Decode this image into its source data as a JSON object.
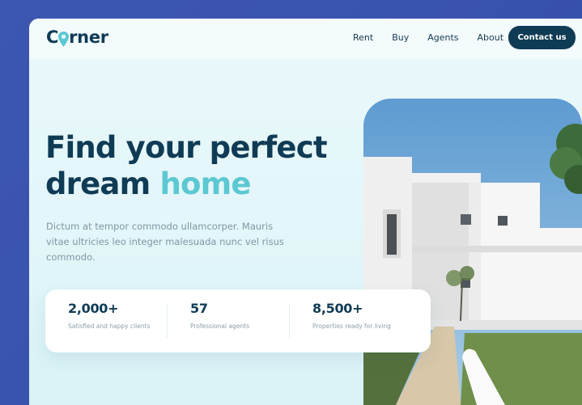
{
  "brand": {
    "name": "Corner",
    "accent": "#5bc8d2",
    "primary": "#0f3b55"
  },
  "nav": {
    "links": [
      "Rent",
      "Buy",
      "Agents",
      "About"
    ],
    "cta": "Contact us"
  },
  "hero": {
    "title_line1": "Find your perfect",
    "title_line2_a": "dream",
    "title_line2_b": "home",
    "description": "Dictum at tempor commodo ullamcorper. Mauris vitae ultricies leo integer malesuada nunc vel risus commodo."
  },
  "stats": [
    {
      "value": "2,000+",
      "label": "Satisfied and happy clients"
    },
    {
      "value": "57",
      "label": "Professional agents"
    },
    {
      "value": "8,500+",
      "label": "Properties ready for living"
    }
  ],
  "image": {
    "icon": "house-photo"
  }
}
